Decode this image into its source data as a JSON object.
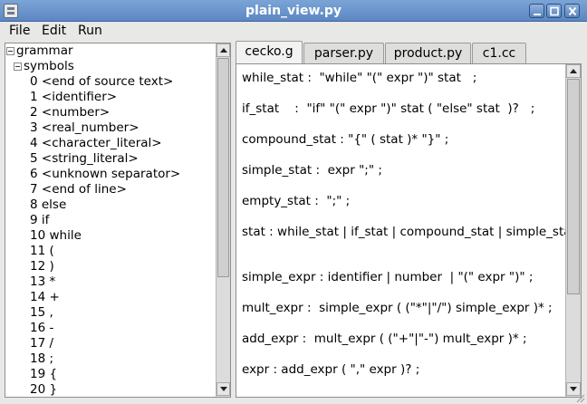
{
  "window": {
    "title": "plain_view.py"
  },
  "menu": {
    "file": "File",
    "edit": "Edit",
    "run": "Run"
  },
  "tree": {
    "root": "grammar",
    "group": "symbols",
    "items": [
      "0 <end of source text>",
      "1 <identifier>",
      "2 <number>",
      "3 <real_number>",
      "4 <character_literal>",
      "5 <string_literal>",
      "6 <unknown separator>",
      "7 <end of line>",
      "8 else",
      "9 if",
      "10 while",
      "11 (",
      "12 )",
      "13 *",
      "14 +",
      "15 ,",
      "16 -",
      "17 /",
      "18 ;",
      "19 {",
      "20 }"
    ]
  },
  "tabs": [
    "cecko.g",
    "parser.py",
    "product.py",
    "c1.cc"
  ],
  "active_tab": "cecko.g",
  "code": [
    "while_stat :  \"while\" \"(\" expr \")\" stat   ;",
    "if_stat    :  \"if\" \"(\" expr \")\" stat ( \"else\" stat  )?   ;",
    "compound_stat : \"{\" ( stat )* \"}\" ;",
    "simple_stat :  expr \";\" ;",
    "empty_stat :  \";\" ;",
    "stat : while_stat | if_stat | compound_stat | simple_stat | empty_stat ;",
    "simple_expr : identifier | number  | \"(\" expr \")\" ;",
    "mult_expr :  simple_expr ( (\"*\"|\"/\") simple_expr )* ;",
    "add_expr :  mult_expr ( (\"+\"|\"-\") mult_expr )* ;",
    "expr : add_expr ( \",\" expr )? ;"
  ]
}
